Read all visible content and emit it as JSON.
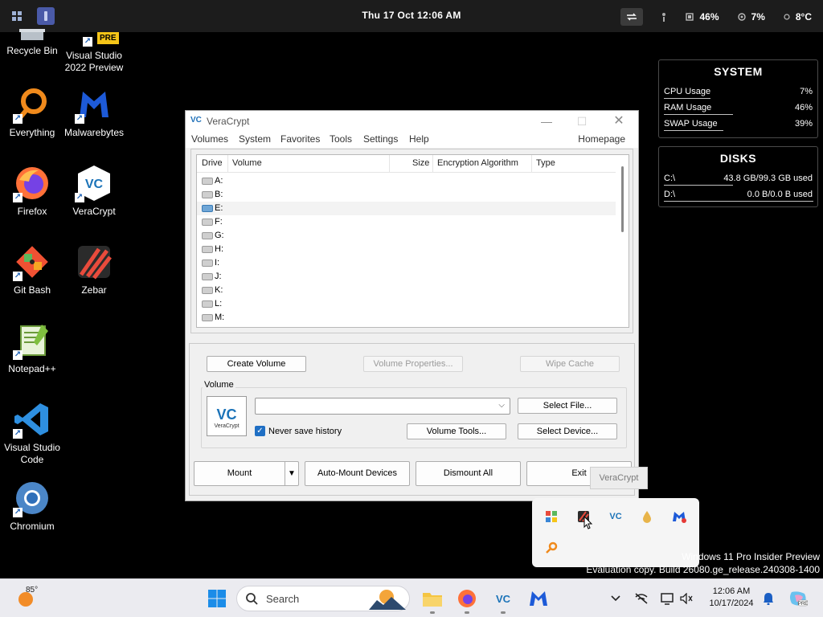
{
  "topbar": {
    "clock": "Thu 17 Oct 12:06 AM",
    "cpu": "46%",
    "mem": "7%",
    "temp": "8°C"
  },
  "desktop": {
    "icons": [
      {
        "label": "Recycle Bin"
      },
      {
        "label": "Visual Studio 2022 Preview",
        "badge": "PRE"
      },
      {
        "label": "Everything"
      },
      {
        "label": "Malwarebytes"
      },
      {
        "label": "Firefox"
      },
      {
        "label": "VeraCrypt"
      },
      {
        "label": "Git Bash"
      },
      {
        "label": "Zebar"
      },
      {
        "label": "Notepad++"
      },
      {
        "label": "Visual Studio Code"
      },
      {
        "label": "Chromium"
      }
    ]
  },
  "system_panel": {
    "title": "SYSTEM",
    "rows": [
      {
        "label": "CPU Usage",
        "value": "7%",
        "fraction": 0.07
      },
      {
        "label": "RAM Usage",
        "value": "46%",
        "fraction": 0.46
      },
      {
        "label": "SWAP Usage",
        "value": "39%",
        "fraction": 0.39
      }
    ]
  },
  "disks_panel": {
    "title": "DISKS",
    "rows": [
      {
        "label": "C:\\",
        "value": "43.8 GB/99.3 GB used",
        "fraction": 0.44
      },
      {
        "label": "D:\\",
        "value": "0.0 B/0.0 B used",
        "fraction": 1.0
      }
    ]
  },
  "veracrypt": {
    "title": "VeraCrypt",
    "menu": [
      "Volumes",
      "System",
      "Favorites",
      "Tools",
      "Settings",
      "Help"
    ],
    "homepage": "Homepage",
    "columns": [
      "Drive",
      "Volume",
      "Size",
      "Encryption Algorithm",
      "Type"
    ],
    "drives": [
      "A:",
      "B:",
      "E:",
      "F:",
      "G:",
      "H:",
      "I:",
      "J:",
      "K:",
      "L:",
      "M:"
    ],
    "selected_drive": "E:",
    "buttons": {
      "create_volume": "Create Volume",
      "volume_properties": "Volume Properties...",
      "wipe_cache": "Wipe Cache",
      "select_file": "Select File...",
      "volume_tools": "Volume Tools...",
      "select_device": "Select Device...",
      "mount": "Mount",
      "auto_mount": "Auto-Mount Devices",
      "dismount_all": "Dismount All",
      "exit": "Exit"
    },
    "volume_group_label": "Volume",
    "volume_path": "",
    "never_save_history": "Never save history",
    "never_save_history_checked": true,
    "logo_text": "VeraCrypt",
    "tooltip": "VeraCrypt"
  },
  "watermark": {
    "line1": "Windows 11 Pro Insider Preview",
    "line2": "Evaluation copy. Build 26080.ge_release.240308-1400"
  },
  "taskbar": {
    "weather_temp": "85°",
    "search_placeholder": "Search",
    "time": "12:06 AM",
    "date": "10/17/2024"
  }
}
